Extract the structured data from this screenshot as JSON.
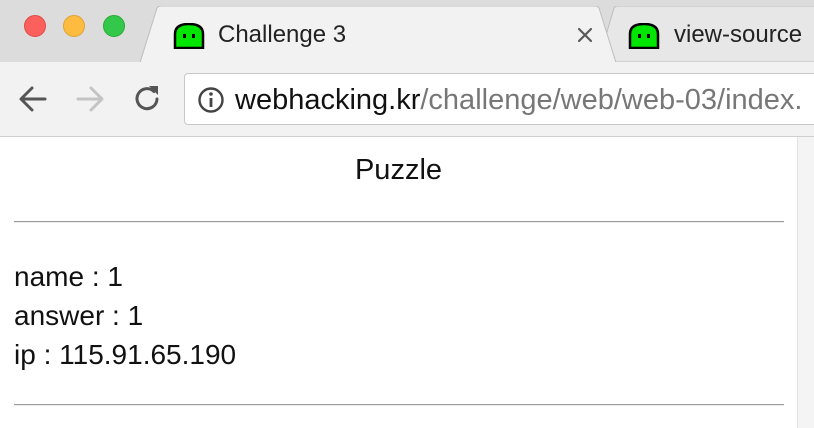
{
  "window": {
    "controls": [
      "close",
      "minimize",
      "maximize"
    ]
  },
  "tabs": [
    {
      "title": "Challenge 3",
      "favicon": "green-ghost-icon",
      "active": true
    },
    {
      "title": "view-source",
      "favicon": "green-ghost-icon",
      "active": false
    }
  ],
  "toolbar": {
    "back_icon": "back-arrow-icon",
    "forward_icon": "forward-arrow-icon",
    "reload_icon": "reload-icon",
    "address": {
      "security_icon": "info-icon",
      "host": "webhacking.kr",
      "path": "/challenge/web/web-03/index."
    }
  },
  "page": {
    "heading": "Puzzle",
    "lines": {
      "name": "name : 1",
      "answer": "answer : 1",
      "ip": "ip : 115.91.65.190"
    }
  },
  "colors": {
    "titlebar": "#dcdcdc",
    "tab_active": "#f2f2f2",
    "favicon_green": "#00e600"
  }
}
